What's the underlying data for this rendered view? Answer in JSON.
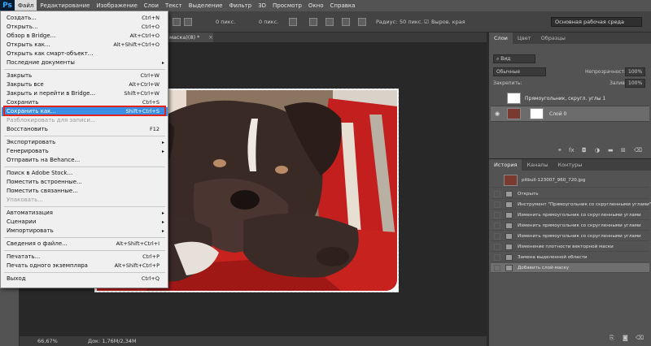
{
  "menubar": {
    "logo": "Ps",
    "items": [
      "Файл",
      "Редактирование",
      "Изображение",
      "Слои",
      "Текст",
      "Выделение",
      "Фильтр",
      "3D",
      "Просмотр",
      "Окно",
      "Справка"
    ]
  },
  "options_bar": {
    "feather_value": "0 пикс.",
    "width_value": "0 пикс.",
    "radius_label": "Радиус:",
    "radius_value": "50 пикс.",
    "align_edges_label": "Выров. края",
    "workspace": "Основная рабочая среда"
  },
  "document": {
    "tab_title": "маска)(8) *",
    "zoom": "66,67%",
    "doc_size": "Док: 1,76M/2,34M"
  },
  "file_menu": {
    "items": [
      {
        "label": "Создать...",
        "shortcut": "Ctrl+N"
      },
      {
        "label": "Открыть...",
        "shortcut": "Ctrl+O"
      },
      {
        "label": "Обзор в Bridge...",
        "shortcut": "Alt+Ctrl+O"
      },
      {
        "label": "Открыть как...",
        "shortcut": "Alt+Shift+Ctrl+O"
      },
      {
        "label": "Открыть как смарт-объект...",
        "shortcut": ""
      },
      {
        "label": "Последние документы",
        "shortcut": "",
        "submenu": true
      },
      {
        "label": "Закрыть",
        "shortcut": "Ctrl+W"
      },
      {
        "label": "Закрыть все",
        "shortcut": "Alt+Ctrl+W"
      },
      {
        "label": "Закрыть и перейти в Bridge...",
        "shortcut": "Shift+Ctrl+W"
      },
      {
        "label": "Сохранить",
        "shortcut": "Ctrl+S"
      },
      {
        "label": "Сохранить как...",
        "shortcut": "Shift+Ctrl+S",
        "highlighted": true
      },
      {
        "label": "Разблокировать для записи...",
        "shortcut": "",
        "disabled": true
      },
      {
        "label": "Восстановить",
        "shortcut": "F12"
      },
      {
        "label": "Экспортировать",
        "shortcut": "",
        "submenu": true
      },
      {
        "label": "Генерировать",
        "shortcut": "",
        "submenu": true
      },
      {
        "label": "Отправить на Behance...",
        "shortcut": ""
      },
      {
        "label": "Поиск в Adobe Stock...",
        "shortcut": ""
      },
      {
        "label": "Поместить встроенные...",
        "shortcut": ""
      },
      {
        "label": "Поместить связанные...",
        "shortcut": ""
      },
      {
        "label": "Упаковать...",
        "shortcut": "",
        "disabled": true
      },
      {
        "label": "Автоматизация",
        "shortcut": "",
        "submenu": true
      },
      {
        "label": "Сценарии",
        "shortcut": "",
        "submenu": true
      },
      {
        "label": "Импортировать",
        "shortcut": "",
        "submenu": true
      },
      {
        "label": "Сведения о файле...",
        "shortcut": "Alt+Shift+Ctrl+I"
      },
      {
        "label": "Печатать...",
        "shortcut": "Ctrl+P"
      },
      {
        "label": "Печать одного экземпляра",
        "shortcut": "Alt+Shift+Ctrl+P"
      },
      {
        "label": "Выход",
        "shortcut": "Ctrl+Q"
      }
    ]
  },
  "layers_panel": {
    "tabs": [
      "Слои",
      "Цвет",
      "Образцы"
    ],
    "filter_kind": "Вид",
    "blend_mode": "Обычные",
    "opacity_label": "Непрозрачность:",
    "opacity_value": "100%",
    "lock_label": "Закрепить:",
    "fill_label": "Заливка:",
    "fill_value": "100%",
    "layers": [
      {
        "name": "Прямоугольник, скругл. углы 1"
      },
      {
        "name": "Слой 0",
        "selected": true
      }
    ]
  },
  "history_panel": {
    "tabs": [
      "История",
      "Каналы",
      "Контуры"
    ],
    "snapshot": "pitbull-123007_960_720.jpg",
    "items": [
      {
        "label": "Открыть"
      },
      {
        "label": "Инструмент \"Прямоугольник со скругленными углами\""
      },
      {
        "label": "Изменить прямоугольник со скругленными углами"
      },
      {
        "label": "Изменить прямоугольник со скругленными углами"
      },
      {
        "label": "Изменить прямоугольник со скругленными углами"
      },
      {
        "label": "Изменение плотности векторной маски"
      },
      {
        "label": "Замена выделенной области"
      },
      {
        "label": "Добавить слой-маску",
        "selected": true
      }
    ]
  },
  "icons": {
    "eye": "eye-icon",
    "chevron": "chevron-right-icon",
    "accent": "#3a8ee6",
    "highlight_box": "#e2231a"
  }
}
